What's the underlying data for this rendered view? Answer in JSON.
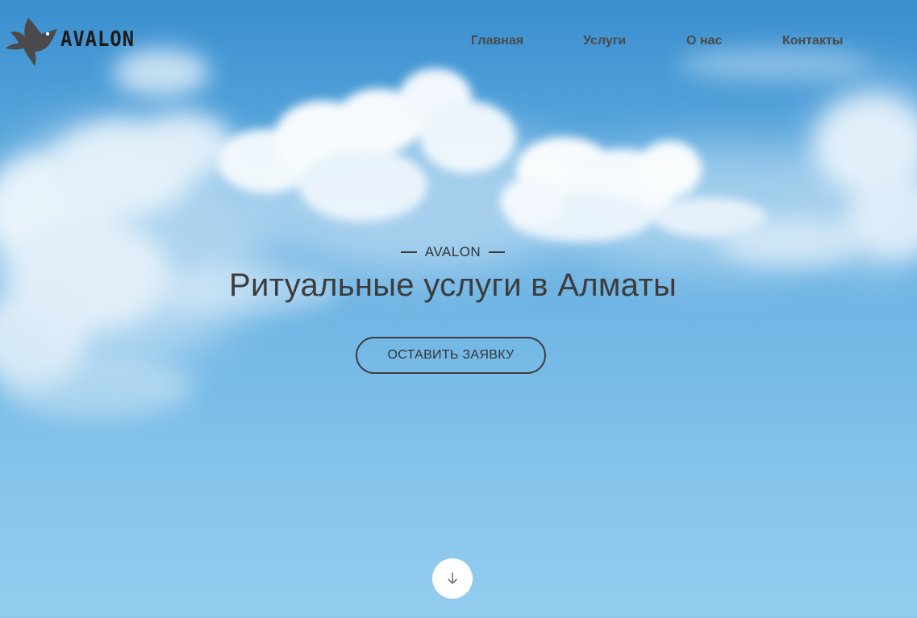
{
  "brand": {
    "name": "AVALON",
    "logo_icon": "dove-icon",
    "logo_color": "#4a4a4a"
  },
  "nav": {
    "items": [
      {
        "label": "Главная"
      },
      {
        "label": "Услуги"
      },
      {
        "label": "О нас"
      },
      {
        "label": "Контакты"
      }
    ]
  },
  "hero": {
    "eyebrow": "AVALON",
    "title": "Ритуальные услуги в Алматы",
    "cta_label": "ОСТАВИТЬ ЗАЯВКУ",
    "scroll_icon": "arrow-down-icon"
  },
  "colors": {
    "sky_top": "#3a8fcf",
    "sky_bottom": "#93cdef",
    "text_dark": "#3c3c3c",
    "button_border": "#3e3e3e"
  }
}
